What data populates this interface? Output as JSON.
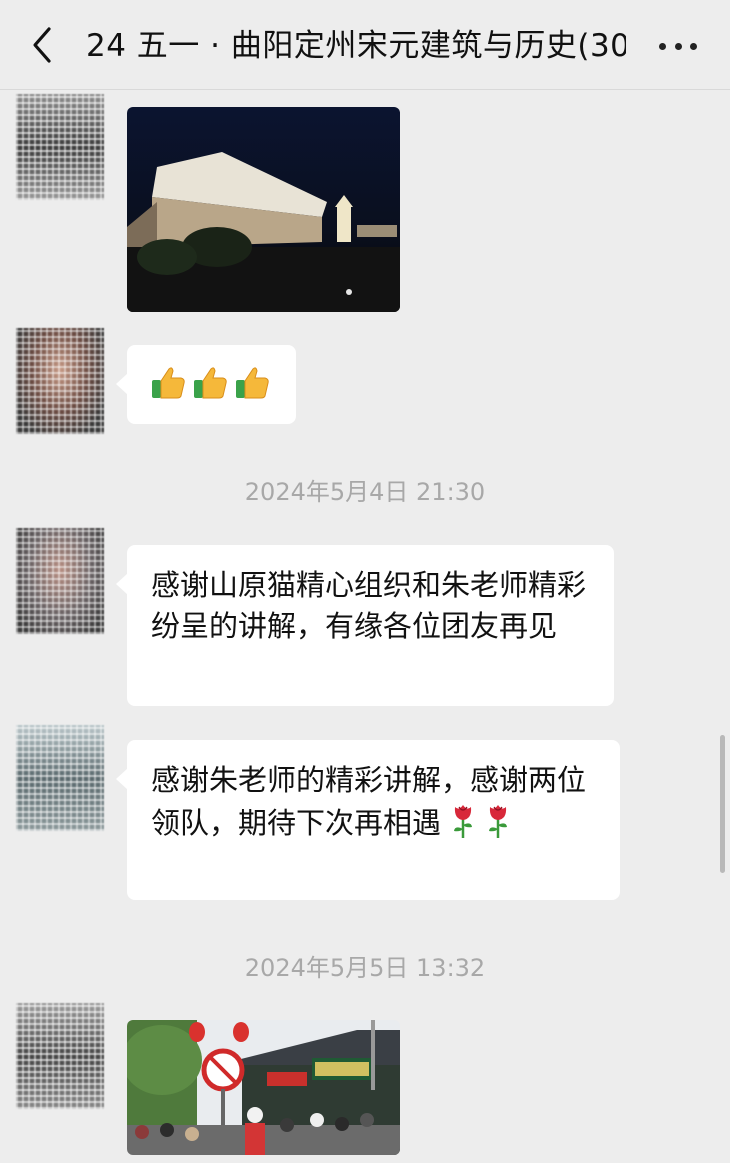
{
  "header": {
    "title": "24 五一 · 曲阳定州宋元建筑与历史(30)",
    "back_icon": "chevron-left-icon",
    "more_icon": "more-dots-icon"
  },
  "messages": [
    {
      "type": "image",
      "description_icon": "night-architecture-photo"
    },
    {
      "type": "emoji",
      "icon": "thumbs-up-icon",
      "count": 3
    },
    {
      "type": "timestamp",
      "text": "2024年5月4日 21:30"
    },
    {
      "type": "text",
      "text": "感谢山原猫精心组织和朱老师精彩纷呈的讲解，有缘各位团友再见"
    },
    {
      "type": "text",
      "text": "感谢朱老师的精彩讲解，感谢两位领队，期待下次再相遇",
      "trailing_icons": [
        "rose-icon",
        "rose-icon"
      ]
    },
    {
      "type": "timestamp",
      "text": "2024年5月5日 13:32"
    },
    {
      "type": "image",
      "description_icon": "street-shop-photo"
    }
  ],
  "colors": {
    "background": "#ededed",
    "bubble": "#ffffff",
    "timestamp": "#a8a8a8"
  }
}
